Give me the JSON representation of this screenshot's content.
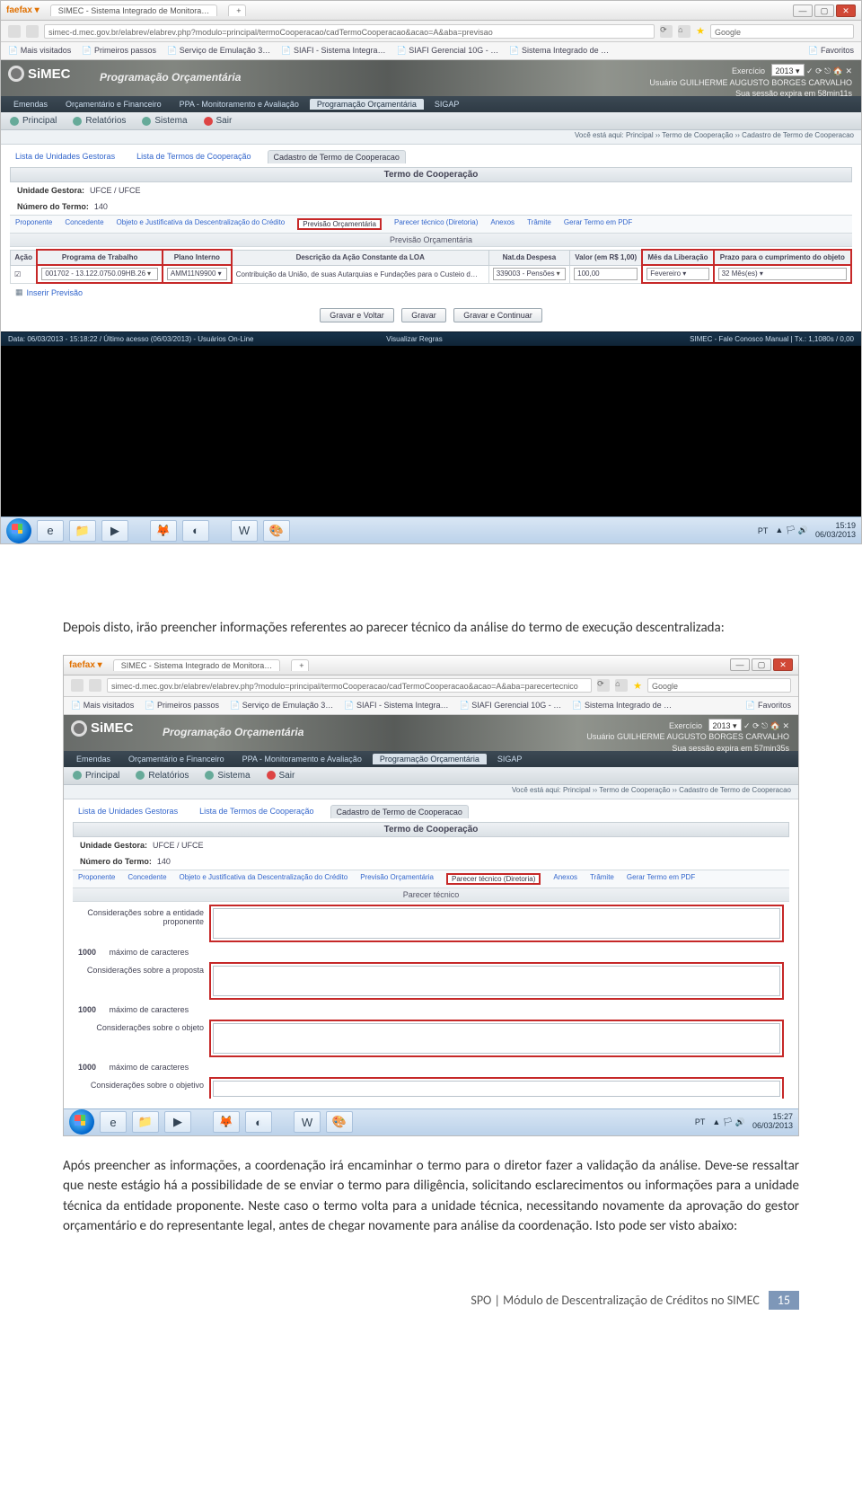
{
  "browser": {
    "ff_label": "faefax ▾",
    "tab_title": "SIMEC - Sistema Integrado de Monitora…",
    "url1": "simec-d.mec.gov.br/elabrev/elabrev.php?modulo=principal/termoCooperacao/cadTermoCooperacao&acao=A&aba=previsao",
    "url2": "simec-d.mec.gov.br/elabrev/elabrev.php?modulo=principal/termoCooperacao/cadTermoCooperacao&acao=A&aba=parecertecnico",
    "search_placeholder": "Google",
    "bookmarks": [
      "Mais visitados",
      "Primeiros passos",
      "Serviço de Emulação 3…",
      "SIAFI - Sistema Integra…",
      "SIAFI Gerencial 10G - …",
      "Sistema Integrado de …"
    ],
    "favoritos": "Favoritos"
  },
  "simec": {
    "brand": "SiMEC",
    "subtitle": "Programação Orçamentária",
    "exercicio_label": "Exercício",
    "exercicio_value": "2013 ▾",
    "usuario_label": "Usuário",
    "usuario_value": "GUILHERME AUGUSTO BORGES CARVALHO",
    "session1": "Sua sessão expira em 58min11s",
    "session2": "Sua sessão expira em 57min35s",
    "toptabs": [
      "Emendas",
      "Orçamentário e Financeiro",
      "PPA - Monitoramento e Avaliação",
      "Programação Orçamentária",
      "SIGAP"
    ],
    "menus": {
      "principal": "Principal",
      "relatorios": "Relatórios",
      "sistema": "Sistema",
      "sair": "Sair"
    },
    "breadcrumb": "Você está aqui: Principal ›› Termo de Cooperação ›› Cadastro de Termo de Cooperacao",
    "subtabs": [
      "Lista de Unidades Gestoras",
      "Lista de Termos de Cooperação",
      "Cadastro de Termo de Cooperacao"
    ],
    "panel_title": "Termo de Cooperação",
    "unidade_gestora_label": "Unidade Gestora:",
    "unidade_gestora_value": "UFCE / UFCE",
    "numero_termo_label": "Número do Termo:",
    "numero_termo_value": "140",
    "linktabs": [
      "Proponente",
      "Concedente",
      "Objeto e Justificativa da Descentralização do Crédito",
      "Previsão Orçamentária",
      "Parecer técnico (Diretoria)",
      "Anexos",
      "Trâmite",
      "Gerar Termo em PDF"
    ]
  },
  "shot1": {
    "subpanel": "Previsão Orçamentária",
    "grid": {
      "headers": [
        "Ação",
        "Programa de Trabalho",
        "Plano Interno",
        "Descrição da Ação Constante da LOA",
        "Nat.da Despesa",
        "Valor (em R$ 1,00)",
        "Mês da Liberação",
        "Prazo para o cumprimento do objeto"
      ],
      "row": {
        "acao_icon": "☑",
        "programa": "001702 - 13.122.0750.09HB.26",
        "plano": "AMM11N9900 ▾",
        "descricao": "Contribuição da União, de suas Autarquias e Fundações para o Custeio d…",
        "natureza": "339003 - Pensões",
        "valor": "100,00",
        "mes": "Fevereiro ▾",
        "prazo": "32 Mês(es) ▾"
      }
    },
    "inserir": "Inserir Previsão",
    "buttons": [
      "Gravar e Voltar",
      "Gravar",
      "Gravar e Continuar"
    ],
    "status_left": "Data: 06/03/2013 - 15:18:22 / Último acesso (06/03/2013) - Usuários On-Line",
    "status_center": "Visualizar Regras",
    "status_right": "SIMEC - Fale Conosco Manual   | Tx.: 1,1080s / 0,00",
    "taskbar": {
      "time": "15:19",
      "date": "06/03/2013",
      "lang": "PT",
      "kb": "▲ 🏳 🔊"
    }
  },
  "shot2": {
    "subpanel": "Parecer técnico",
    "rows": [
      {
        "label": "Considerações sobre a entidade proponente"
      },
      {
        "label": "Considerações sobre a proposta"
      },
      {
        "label": "Considerações sobre o objeto"
      },
      {
        "label": "Considerações sobre o objetivo"
      }
    ],
    "counter_text": "máximo de caracteres",
    "counter_num": "1000",
    "taskbar": {
      "time": "15:27",
      "date": "06/03/2013",
      "lang": "PT",
      "kb": "▲ 🏳 🔊"
    }
  },
  "document": {
    "para1": "Depois disto, irão preencher informações referentes ao parecer técnico da análise do termo de execução descentralizada:",
    "para2": "Após preencher as informações, a coordenação irá encaminhar o termo para o diretor fazer a validação da análise. Deve-se ressaltar que neste estágio há a possibilidade de se enviar o termo para diligência, solicitando esclarecimentos ou informações para a unidade técnica da entidade proponente. Neste caso o termo volta para a unidade técnica, necessitando novamente da aprovação do gestor orçamentário e do representante legal, antes de chegar novamente para análise da coordenação. Isto pode ser visto abaixo:",
    "footer_text": "SPO | Módulo de Descentralização de Créditos no SIMEC",
    "page_number": "15"
  }
}
